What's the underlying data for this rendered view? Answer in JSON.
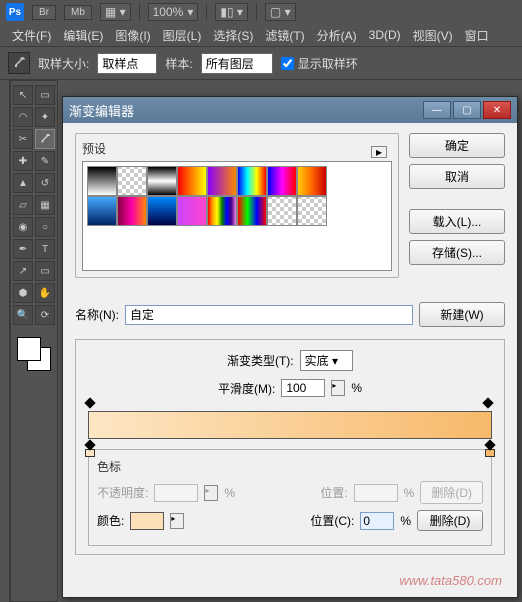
{
  "header": {
    "ps": "Ps",
    "br": "Br",
    "mb": "Mb",
    "zoom": "100%"
  },
  "menu": {
    "file": "文件(F)",
    "edit": "编辑(E)",
    "image": "图像(I)",
    "layer": "图层(L)",
    "select": "选择(S)",
    "filter": "滤镜(T)",
    "analysis": "分析(A)",
    "threeD": "3D(D)",
    "view": "视图(V)",
    "window": "窗口"
  },
  "options": {
    "sample_size_label": "取样大小:",
    "sample_size_value": "取样点",
    "sample_label": "样本:",
    "sample_value": "所有图层",
    "show_ring": "显示取样环"
  },
  "dialog": {
    "title": "渐变编辑器",
    "presets_label": "预设",
    "ok": "确定",
    "cancel": "取消",
    "load": "载入(L)...",
    "save": "存储(S)...",
    "name_label": "名称(N):",
    "name_value": "自定",
    "new_btn": "新建(W)",
    "grad_type_label": "渐变类型(T):",
    "grad_type_value": "实底",
    "smoothness_label": "平滑度(M):",
    "smoothness_value": "100",
    "percent": "%",
    "stops_label": "色标",
    "opacity_label": "不透明度:",
    "location_label": "位置:",
    "location_c_label": "位置(C):",
    "location_value": "0",
    "color_label": "颜色:",
    "delete_d": "删除(D)",
    "delete_disabled": "删除(D)",
    "gradient": {
      "start": "#fde6c4",
      "end": "#f7b96a"
    },
    "color_stop_color": "#fde0b8"
  },
  "presets": [
    [
      "linear-gradient(#000,#fff)",
      "repeating-conic-gradient(#ccc 0 25%,#fff 0 50%) 0/8px 8px",
      "linear-gradient(#000,#fff,#000)",
      "linear-gradient(to right,#f00,#ff0)",
      "linear-gradient(to right,#80f,#f80)",
      "linear-gradient(to right,#00f,#0ff,#ff0,#f00)",
      "linear-gradient(to right,#00f,#f0f,#f00)",
      "linear-gradient(to right,#fc0,#f60,#c00)"
    ],
    [
      "linear-gradient(#4af,#026)",
      "linear-gradient(to right,#804,#f0a,#f80)",
      "linear-gradient(#08f,#004)",
      "linear-gradient(to right,#c4f,#f4c)",
      "linear-gradient(to right,red,orange,yellow,green,blue,indigo,violet)",
      "linear-gradient(to right,#f00,#0f0,#00f,#f00)",
      "repeating-conic-gradient(#ccc 0 25%,#fff 0 50%) 0/8px 8px",
      "repeating-conic-gradient(#ccc 0 25%,#fff 0 50%) 0/8px 8px"
    ]
  ],
  "watermark": "www.tata580.com"
}
